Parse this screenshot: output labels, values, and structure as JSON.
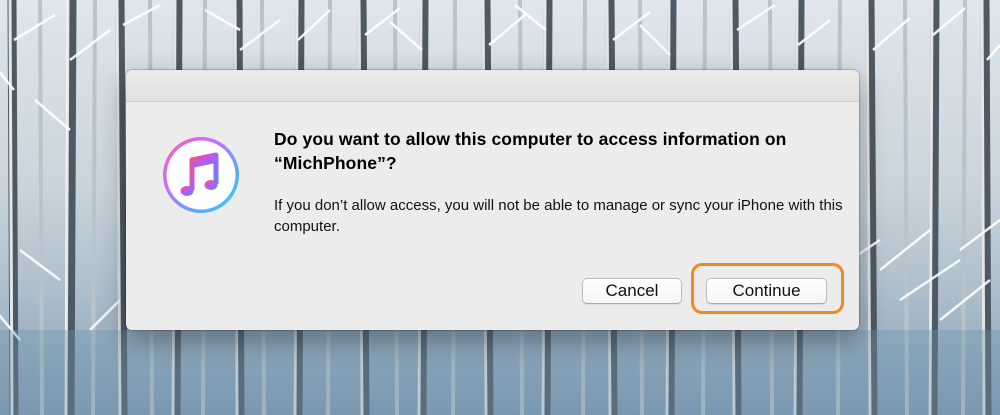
{
  "dialog": {
    "title": "Do you want to allow this computer to access information on “MichPhone”?",
    "message": "If you don’t allow access, you will not be able to manage or sync your iPhone with this computer.",
    "app_icon": "itunes-music-note-icon",
    "buttons": {
      "cancel_label": "Cancel",
      "continue_label": "Continue"
    }
  },
  "colors": {
    "dialog_background": "#ececec",
    "highlight_outline": "#f08a1c"
  }
}
